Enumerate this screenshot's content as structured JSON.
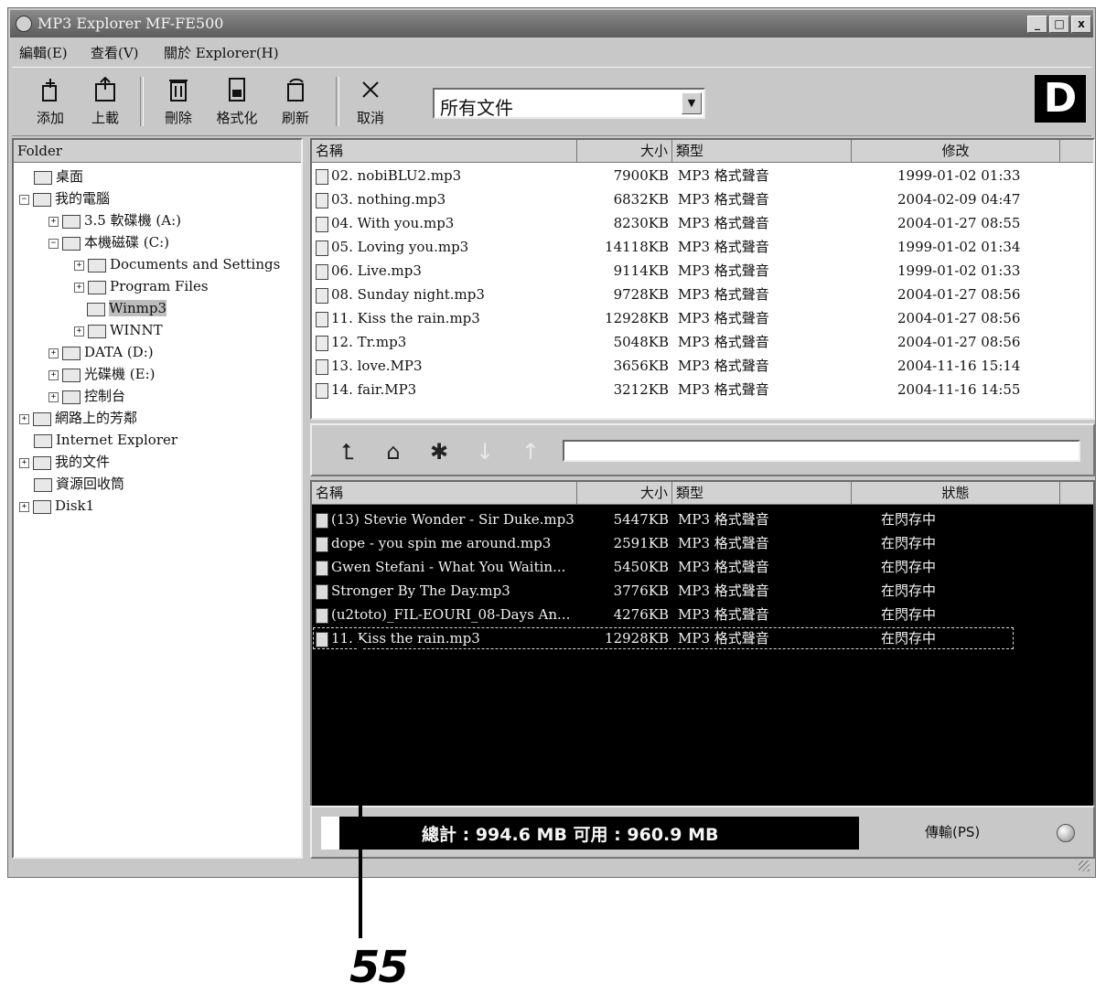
{
  "window": {
    "title": "MP3 Explorer MF-FE500",
    "controls": [
      "_",
      "□",
      "x"
    ]
  },
  "menu": [
    {
      "label": "編輯(E)"
    },
    {
      "label": "查看(V)"
    },
    {
      "label": "關於 Explorer(H)"
    }
  ],
  "toolbar": {
    "buttons": [
      {
        "label": "添加",
        "icon": "add-icon"
      },
      {
        "label": "上載",
        "icon": "upload-icon"
      },
      {
        "label": "刪除",
        "icon": "delete-icon"
      },
      {
        "label": "格式化",
        "icon": "format-icon"
      },
      {
        "label": "刷新",
        "icon": "refresh-icon"
      },
      {
        "label": "取消",
        "icon": "cancel-icon"
      }
    ],
    "filter": "所有文件",
    "logo": "D"
  },
  "folder_pane": {
    "header": "Folder",
    "nodes": [
      {
        "label": "桌面",
        "expander": "",
        "level": 1
      },
      {
        "label": "我的電腦",
        "expander": "−",
        "level": 0
      },
      {
        "label": "3.5 軟碟機 (A:)",
        "expander": "+",
        "level": 2
      },
      {
        "label": "本機磁碟 (C:)",
        "expander": "−",
        "level": 2
      },
      {
        "label": "Documents and Settings",
        "expander": "+",
        "level": 3
      },
      {
        "label": "Program Files",
        "expander": "+",
        "level": 3
      },
      {
        "label": "Winmp3",
        "expander": "",
        "level": 3,
        "selected": true
      },
      {
        "label": "WINNT",
        "expander": "+",
        "level": 3
      },
      {
        "label": "DATA (D:)",
        "expander": "+",
        "level": 2
      },
      {
        "label": "光碟機 (E:)",
        "expander": "+",
        "level": 2
      },
      {
        "label": "控制台",
        "expander": "+",
        "level": 2
      },
      {
        "label": "網路上的芳鄰",
        "expander": "+",
        "level": 0
      },
      {
        "label": "Internet Explorer",
        "expander": "",
        "level": 1
      },
      {
        "label": "我的文件",
        "expander": "+",
        "level": 0
      },
      {
        "label": "資源回收筒",
        "expander": "",
        "level": 1
      },
      {
        "label": "Disk1",
        "expander": "+",
        "level": 0
      }
    ]
  },
  "pc_files": {
    "columns": {
      "name": "名稱",
      "size": "大小",
      "type": "類型",
      "date": "修改"
    },
    "rows": [
      {
        "name": "02. nobiBLU2.mp3",
        "size": "7900KB",
        "type": "MP3 格式聲音",
        "date": "1999-01-02 01:33"
      },
      {
        "name": "03. nothing.mp3",
        "size": "6832KB",
        "type": "MP3 格式聲音",
        "date": "2004-02-09 04:47"
      },
      {
        "name": "04. With you.mp3",
        "size": "8230KB",
        "type": "MP3 格式聲音",
        "date": "2004-01-27 08:55"
      },
      {
        "name": "05. Loving you.mp3",
        "size": "14118KB",
        "type": "MP3 格式聲音",
        "date": "1999-01-02 01:34"
      },
      {
        "name": "06. Live.mp3",
        "size": "9114KB",
        "type": "MP3 格式聲音",
        "date": "1999-01-02 01:33"
      },
      {
        "name": "08. Sunday night.mp3",
        "size": "9728KB",
        "type": "MP3 格式聲音",
        "date": "2004-01-27 08:56"
      },
      {
        "name": "11. Kiss the rain.mp3",
        "size": "12928KB",
        "type": "MP3 格式聲音",
        "date": "2004-01-27 08:56"
      },
      {
        "name": "12. Tr.mp3",
        "size": "5048KB",
        "type": "MP3 格式聲音",
        "date": "2004-01-27 08:56"
      },
      {
        "name": "13. love.MP3",
        "size": "3656KB",
        "type": "MP3 格式聲音",
        "date": "2004-11-16 15:14"
      },
      {
        "name": "14. fair.MP3",
        "size": "3212KB",
        "type": "MP3 格式聲音",
        "date": "2004-11-16 14:55"
      }
    ]
  },
  "nav": {
    "buttons": [
      {
        "icon": "up-folder-icon",
        "enabled": true
      },
      {
        "icon": "home-icon",
        "enabled": true
      },
      {
        "icon": "new-folder-icon",
        "enabled": true
      },
      {
        "icon": "arrow-down-icon",
        "enabled": false
      },
      {
        "icon": "arrow-up-icon",
        "enabled": false
      }
    ],
    "path": ""
  },
  "device_files": {
    "columns": {
      "name": "名稱",
      "size": "大小",
      "type": "類型",
      "status": "狀態"
    },
    "rows": [
      {
        "name": "(13) Stevie Wonder - Sir Duke.mp3",
        "size": "5447KB",
        "type": "MP3 格式聲音",
        "status": "在閃存中"
      },
      {
        "name": "dope - you spin me around.mp3",
        "size": "2591KB",
        "type": "MP3 格式聲音",
        "status": "在閃存中"
      },
      {
        "name": "Gwen Stefani - What You Waitin...",
        "size": "5450KB",
        "type": "MP3 格式聲音",
        "status": "在閃存中"
      },
      {
        "name": "Stronger By The Day.mp3",
        "size": "3776KB",
        "type": "MP3 格式聲音",
        "status": "在閃存中"
      },
      {
        "name": "(u2toto)_FIL-EOURI_08-Days An...",
        "size": "4276KB",
        "type": "MP3 格式聲音",
        "status": "在閃存中"
      },
      {
        "name": "11. Kiss the rain.mp3",
        "size": "12928KB",
        "type": "MP3 格式聲音",
        "status": "在閃存中",
        "focused": true
      }
    ]
  },
  "status": {
    "capacity_text": "總計 : 994.6 MB    可用 : 960.9 MB",
    "used_fraction": 0.034,
    "transfer": "傳輸(PS)"
  },
  "callout": {
    "number": "55"
  }
}
